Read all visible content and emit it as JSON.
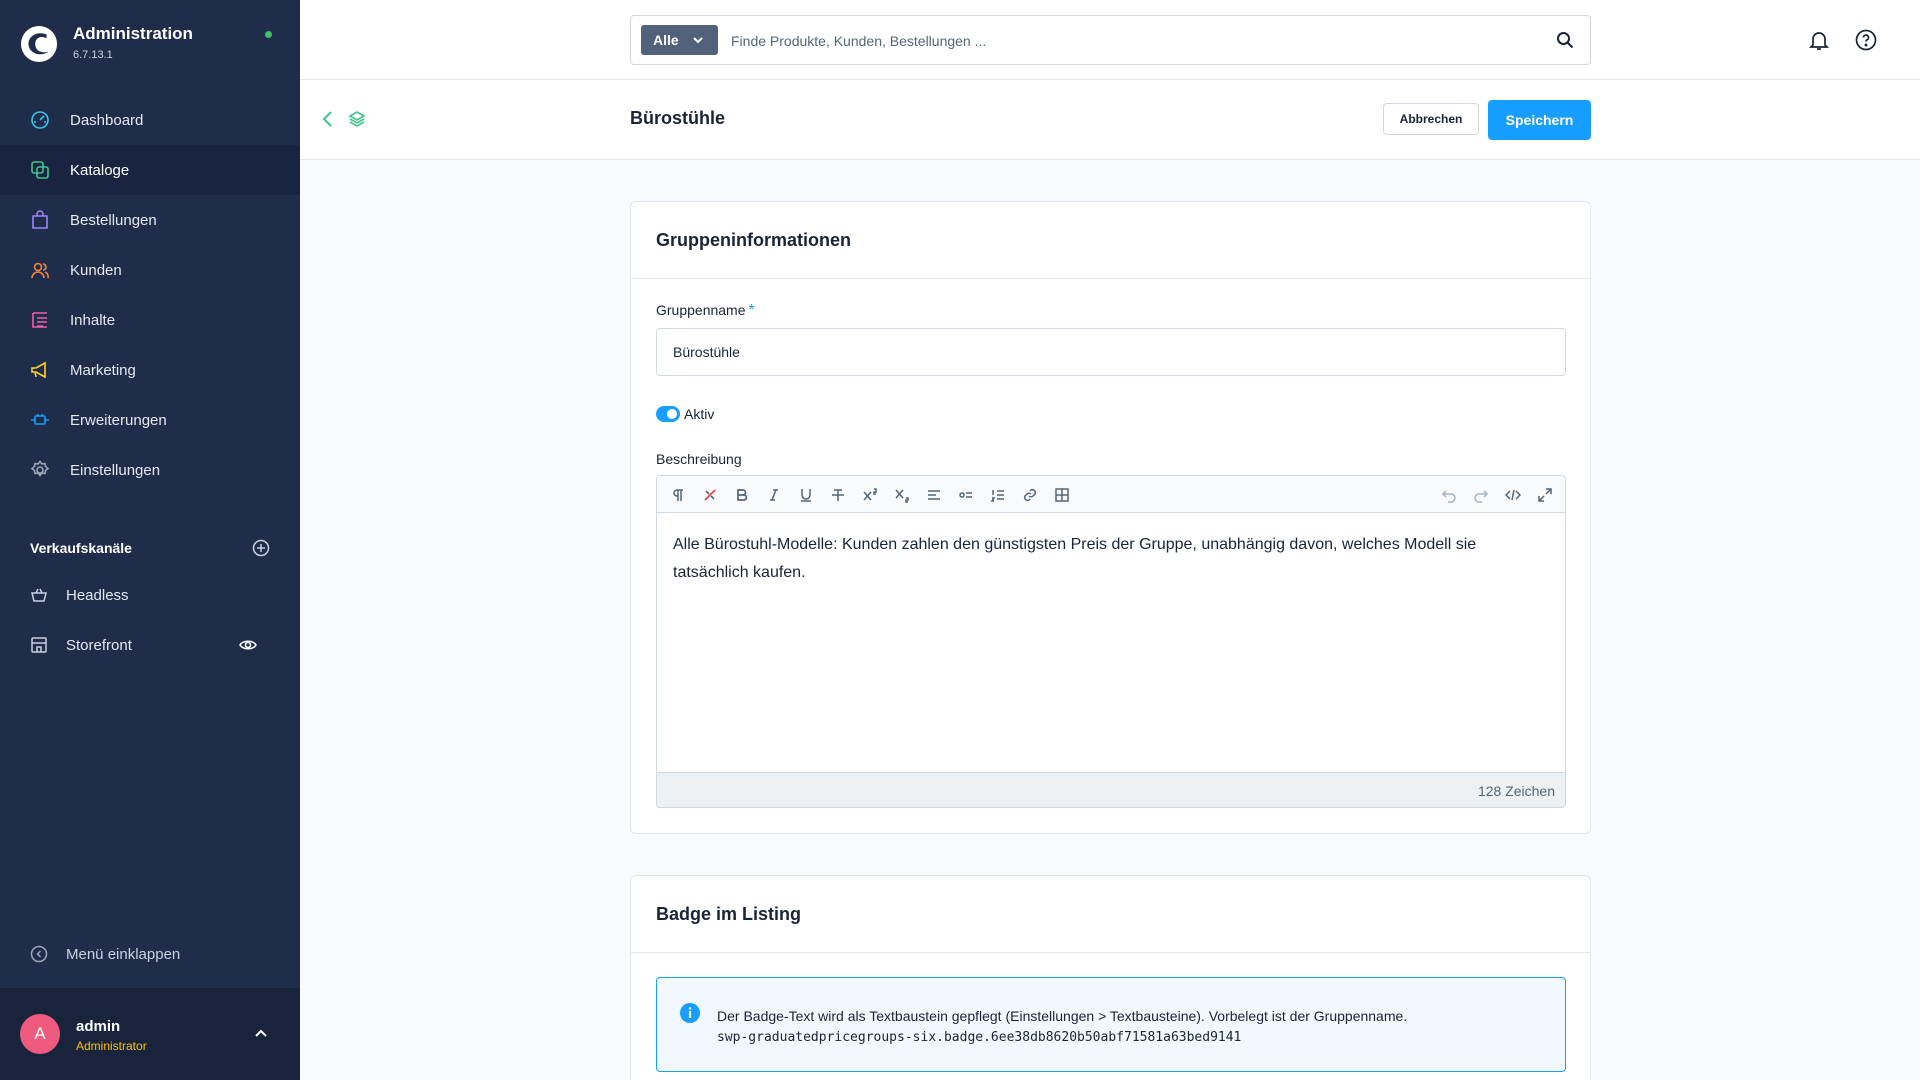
{
  "app": {
    "title": "Administration",
    "version": "6.7.13.1"
  },
  "nav": [
    {
      "label": "Dashboard",
      "icon": "dashboard-icon",
      "color": "#3ec4e8"
    },
    {
      "label": "Kataloge",
      "icon": "catalog-icon",
      "color": "#42c48c",
      "active": true
    },
    {
      "label": "Bestellungen",
      "icon": "orders-icon",
      "color": "#a181f7"
    },
    {
      "label": "Kunden",
      "icon": "customers-icon",
      "color": "#f0853f"
    },
    {
      "label": "Inhalte",
      "icon": "content-icon",
      "color": "#ee5fa6"
    },
    {
      "label": "Marketing",
      "icon": "marketing-icon",
      "color": "#ffd22b"
    },
    {
      "label": "Erweiterungen",
      "icon": "extensions-icon",
      "color": "#189eff"
    },
    {
      "label": "Einstellungen",
      "icon": "settings-icon",
      "color": "#9aa8b5"
    }
  ],
  "sales_channels": {
    "title": "Verkaufskanäle",
    "items": [
      {
        "label": "Headless"
      },
      {
        "label": "Storefront"
      }
    ]
  },
  "collapse_label": "Menü einklappen",
  "user": {
    "initial": "A",
    "name": "admin",
    "role": "Administrator"
  },
  "search": {
    "type": "Alle",
    "placeholder": "Finde Produkte, Kunden, Bestellungen ..."
  },
  "page": {
    "title": "Bürostühle",
    "cancel_label": "Abbrechen",
    "save_label": "Speichern"
  },
  "group_info": {
    "title": "Gruppeninformationen",
    "name_label": "Gruppenname",
    "required_mark": "*",
    "name_value": "Bürostühle",
    "active_label": "Aktiv",
    "active": true,
    "description_label": "Beschreibung",
    "description": "Alle Bürostuhl-Modelle: Kunden zahlen den günstigsten Preis der Gruppe, unabhängig davon, welches Modell sie tatsächlich kaufen.",
    "char_count": "128 Zeichen"
  },
  "badge": {
    "title": "Badge im Listing",
    "info_text": "Der Badge-Text wird als Textbaustein gepflegt (Einstellungen > Textbausteine). Vorbelegt ist der Gruppenname.",
    "snippet_key": "swp-graduatedpricegroups-six.badge.6ee38db8620b50abf71581a63bed9141"
  },
  "colors": {
    "accent": "#189eff",
    "sidebar": "#1f2d4a",
    "online": "#3cc261"
  }
}
